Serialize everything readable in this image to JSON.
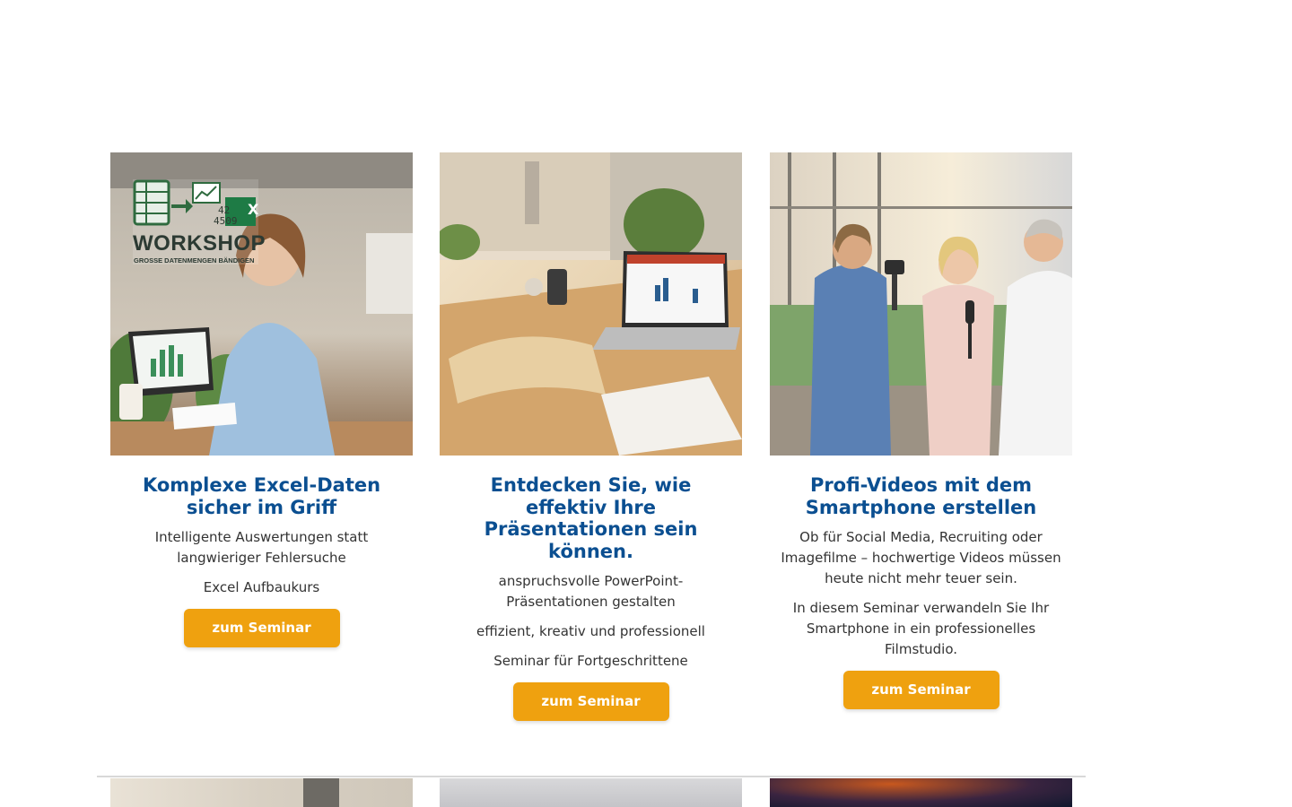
{
  "cards": [
    {
      "title": "Komplexe Excel-Daten sicher im Griff",
      "texts": [
        "Intelligente Auswertungen statt langwieriger Fehlersuche",
        "Excel Aufbaukurs"
      ],
      "button": "zum Seminar",
      "image": {
        "alt": "Frau am Laptop mit Excel Workshop",
        "logo_title": "WORKSHOP",
        "logo_subtitle": "GROSSE DATENMENGEN BÄNDIGEN",
        "logo_numbers": [
          "42",
          "4509"
        ],
        "logo_letter": "X"
      }
    },
    {
      "title": "Entdecken Sie, wie effektiv Ihre Präsentationen sein können.",
      "texts": [
        "anspruchsvolle PowerPoint-Präsentationen gestalten",
        "effizient, kreativ und professionell",
        "Seminar für Fortgeschrittene"
      ],
      "button": "zum Seminar",
      "image": {
        "alt": "Schreibtisch mit Laptop und PowerPoint"
      }
    },
    {
      "title": "Profi-Videos mit dem Smartphone erstellen",
      "texts": [
        "Ob für Social Media, Recruiting oder Imagefilme – hochwertige Videos müssen heute nicht mehr teuer sein.",
        "In diesem Seminar verwandeln Sie Ihr Smartphone in ein professionelles Filmstudio."
      ],
      "button": "zum Seminar",
      "image": {
        "alt": "Videodreh mit Smartphone-Gimbal"
      }
    }
  ],
  "colors": {
    "title": "#0b4f91",
    "button": "#efa10f",
    "text": "#333333"
  }
}
